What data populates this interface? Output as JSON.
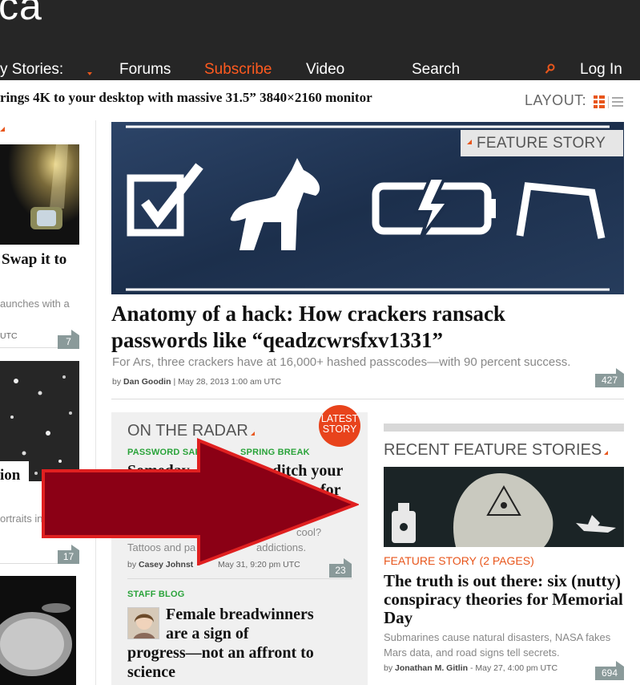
{
  "header": {
    "logo_fragment": "ca",
    "nav": {
      "stories": "y Stories:",
      "forums": "Forums",
      "subscribe": "Subscribe",
      "video": "Video",
      "search": "Search",
      "login": "Log In"
    }
  },
  "ticker": {
    "headline": "rings 4K to your desktop with massive 31.5” 3840×2160 monitor"
  },
  "layout_control": {
    "label": "LAYOUT:"
  },
  "left_column": {
    "story1_title": "Swap it to",
    "story1_dek": "aunches with a",
    "story1_byline": "UTC",
    "story1_comments": "7",
    "story2_title": "ion",
    "story2_dek": "ortraits in",
    "story2_comments": "17"
  },
  "featured": {
    "tag": "FEATURE STORY",
    "headline_line1": "Anatomy of a hack: How crackers ransack",
    "headline_line2": "passwords like “qeadzcwrsfxv1331”",
    "dek": "For Ars, three crackers have at 16,000+ hashed passcodes—with 90 percent success.",
    "byline_prefix": "by",
    "author": "Dan Goodin",
    "date": "| May 28, 2013 1:00 am UTC",
    "comments": "427"
  },
  "radar": {
    "heading": "ON THE RADAR",
    "latest_badge_line1": "LATEST",
    "latest_badge_line2": "STORY",
    "story1": {
      "category": "PASSWORD SAFE",
      "category2": "SPRING BREAK",
      "title_a": "Someday",
      "title_b": "ditch your",
      "title_c": "for",
      "dek_a": "cool?",
      "dek_b": "Tattoos and pa",
      "dek_c": "addictions.",
      "byline_prefix": "by",
      "author": "Casey Johnst",
      "date": "May 31, 9:20 pm UTC",
      "comments": "23"
    },
    "story2": {
      "category": "STAFF BLOG",
      "title_line1": "Female breadwinners",
      "title_line2": "are a sign of",
      "title_line3": "progress—not an affront to",
      "title_line4": "science"
    }
  },
  "recent_features": {
    "heading": "RECENT FEATURE STORIES",
    "label": "FEATURE STORY (2 PAGES)",
    "title": "The truth is out there: six (nutty) conspiracy theories for Memorial Day",
    "dek": "Submarines cause natural disasters, NASA fakes Mars data, and road signs tell secrets.",
    "byline_prefix": "by",
    "author": "Jonathan M. Gitlin",
    "date": "- May 27, 4:00 pm UTC",
    "comments": "694"
  },
  "colors": {
    "accent": "#e8561c",
    "topbar": "#262626",
    "arrow": "#8b0015",
    "green_label": "#2aa33a"
  }
}
